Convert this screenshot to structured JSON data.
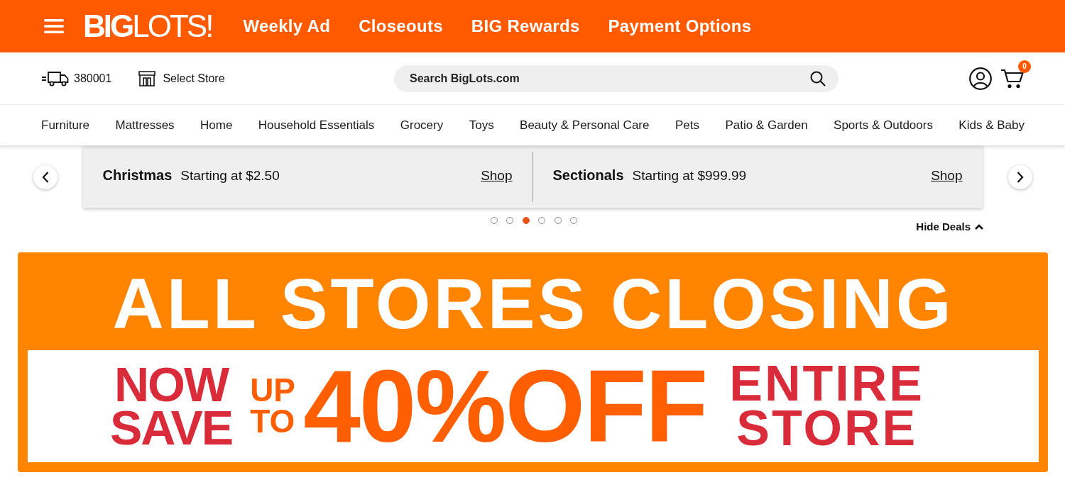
{
  "header": {
    "logo": "**BIG**LOTS!",
    "nav_links": [
      "Weekly Ad",
      "Closeouts",
      "BIG Rewards",
      "Payment Options"
    ]
  },
  "utility_bar": {
    "delivery_zip": "380001",
    "store": "Select Store",
    "search": {
      "placeholder": "Search BigLots.com"
    },
    "cart_count": "0"
  },
  "categories": [
    "Furniture",
    "Mattresses",
    "Home",
    "Household Essentials",
    "Grocery",
    "Toys",
    "Beauty & Personal Care",
    "Pets",
    "Patio & Garden",
    "Sports & Outdoors",
    "Kids & Baby"
  ],
  "deals": {
    "items": [
      {
        "title": "Christmas",
        "price": "Starting at $2.50",
        "link": "Shop"
      },
      {
        "title": "Sectionals",
        "price": "Starting at $999.99",
        "link": "Shop"
      }
    ],
    "dots": [
      {
        "selected": false
      },
      {
        "selected": false
      },
      {
        "selected": true
      },
      {
        "selected": false
      },
      {
        "selected": false
      },
      {
        "selected": false
      }
    ],
    "hide_label": "Hide Deals"
  },
  "banner": {
    "headline": "ALL STORES CLOSING",
    "now_save": "NOW SAVE",
    "up_to": "UP TO",
    "discount": "40%OFF",
    "scope": "ENTIRE STORE"
  }
}
